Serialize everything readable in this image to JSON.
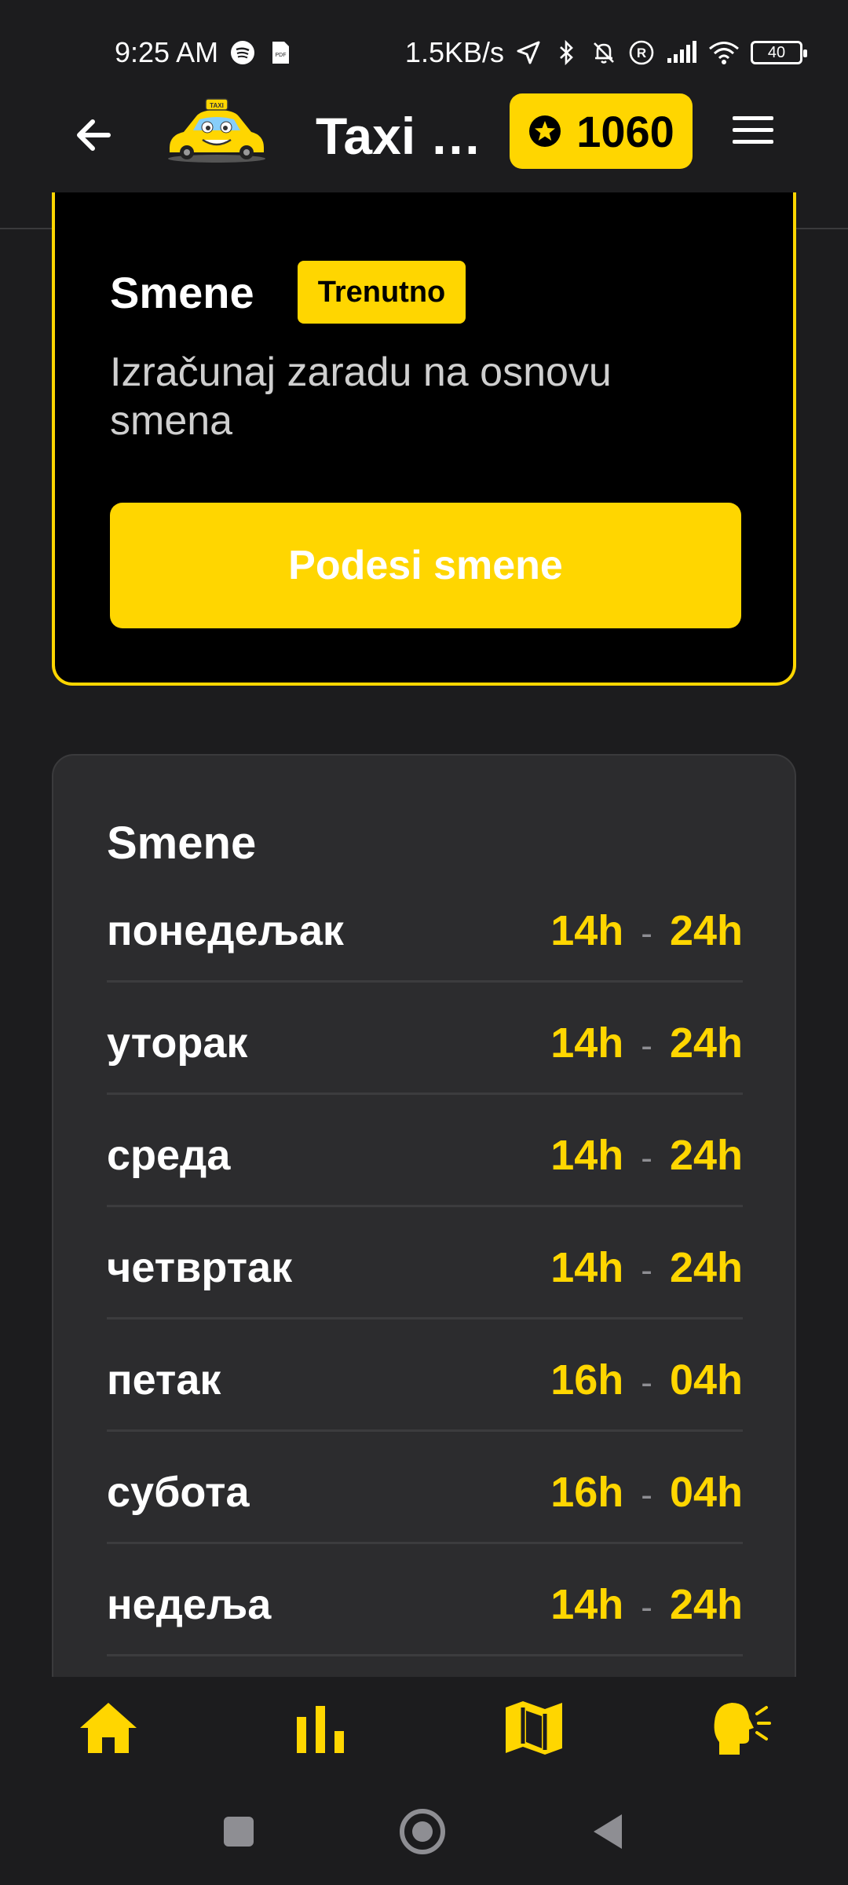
{
  "status_bar": {
    "time": "9:25 AM",
    "network_speed": "1.5KB/s",
    "battery": "40",
    "icons_left": [
      "spotify-icon",
      "pdf-icon"
    ],
    "icons_right": [
      "location-icon",
      "bluetooth-icon",
      "mute-icon",
      "registered-icon",
      "signal-icon",
      "wifi-icon",
      "battery-icon"
    ]
  },
  "header": {
    "title": "Taxi D...",
    "coins": "1060",
    "icons": [
      "back-arrow-icon",
      "taxi-logo",
      "star-coin-icon",
      "hamburger-menu-icon"
    ]
  },
  "current_card": {
    "title": "Smene",
    "badge": "Trenutno",
    "description": "Izračunaj zaradu na osnovu smena",
    "button_label": "Podesi smene"
  },
  "shifts_card": {
    "title": "Smene",
    "separator": "-",
    "rows": [
      {
        "day": "понедељак",
        "start": "14h",
        "end": "24h"
      },
      {
        "day": "уторак",
        "start": "14h",
        "end": "24h"
      },
      {
        "day": "среда",
        "start": "14h",
        "end": "24h"
      },
      {
        "day": "четвртак",
        "start": "14h",
        "end": "24h"
      },
      {
        "day": "петак",
        "start": "16h",
        "end": "04h"
      },
      {
        "day": "субота",
        "start": "16h",
        "end": "04h"
      },
      {
        "day": "недеља",
        "start": "14h",
        "end": "24h"
      }
    ]
  },
  "bottom_nav": {
    "items": [
      "home-icon",
      "stats-icon",
      "map-icon",
      "speaking-icon"
    ]
  },
  "system_nav": {
    "items": [
      "recents-icon",
      "home-circle-icon",
      "back-triangle-icon"
    ]
  },
  "colors": {
    "accent": "#ffd600",
    "background": "#1c1c1e",
    "card": "#2c2c2e"
  }
}
